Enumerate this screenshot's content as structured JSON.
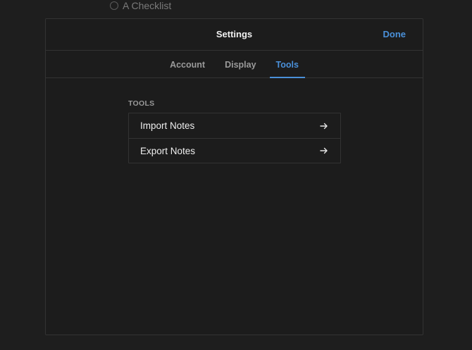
{
  "background": {
    "checklist_item": "A Checklist"
  },
  "modal": {
    "title": "Settings",
    "done_label": "Done",
    "tabs": [
      {
        "label": "Account",
        "active": false
      },
      {
        "label": "Display",
        "active": false
      },
      {
        "label": "Tools",
        "active": true
      }
    ],
    "section": {
      "label": "TOOLS",
      "items": [
        {
          "label": "Import Notes",
          "icon": "arrow-right-icon"
        },
        {
          "label": "Export Notes",
          "icon": "arrow-right-icon"
        }
      ]
    }
  },
  "colors": {
    "accent": "#4a90d9",
    "background": "#1e1e1e",
    "border": "#333333"
  }
}
